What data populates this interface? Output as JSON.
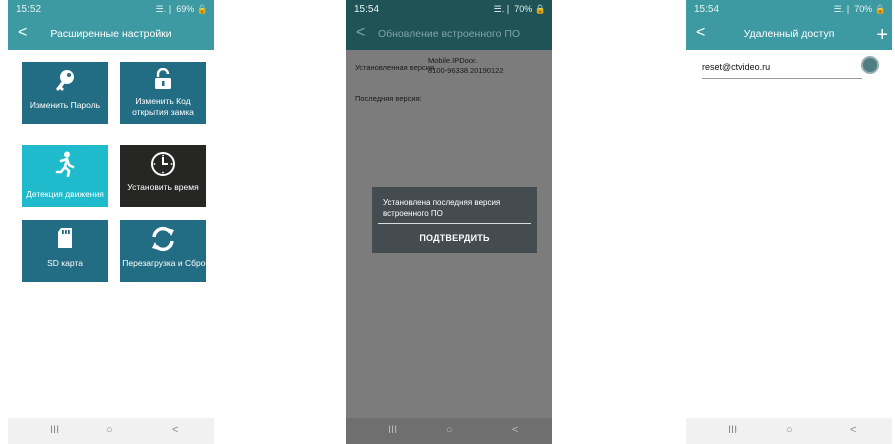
{
  "screen1": {
    "time": "15:52",
    "status_right": "☰.❘ 69% 🔒",
    "title": "Расширенные настройки",
    "back": "<",
    "tiles": [
      {
        "label": "Изменить Пароль",
        "icon": "key-icon"
      },
      {
        "label_line1": "Изменить Код",
        "label_line2": "открытия замка",
        "icon": "unlock-icon"
      },
      {
        "label": "Детекция движения",
        "icon": "running-person-icon"
      },
      {
        "label": "Установить время",
        "icon": "clock-icon"
      },
      {
        "label": "SD карта",
        "icon": "sd-card-icon"
      },
      {
        "label": "Перезагрузка и Сброс",
        "icon": "refresh-icon"
      }
    ]
  },
  "screen2": {
    "time": "15:54",
    "status_right": "☰.❘ 70% 🔒",
    "title": "Обновление встроенного ПО",
    "back": "<",
    "installed_label": "Установленная версия",
    "installed_value_line1": "Mobile.IPDoor.",
    "installed_value_line2": "8100-96338.20190122",
    "latest_label": "Последняя версия:",
    "dialog_message": "Установлена последняя версия встроенного ПО",
    "dialog_button": "ПОДТВЕРДИТЬ"
  },
  "screen3": {
    "time": "15:54",
    "status_right": "☰.❘ 70% 🔒",
    "title": "Удаленный доступ",
    "back": "<",
    "add": "+",
    "entry": "reset@ctvideo.ru"
  },
  "nav": {
    "recent": "III",
    "home": "○",
    "back": "<"
  }
}
